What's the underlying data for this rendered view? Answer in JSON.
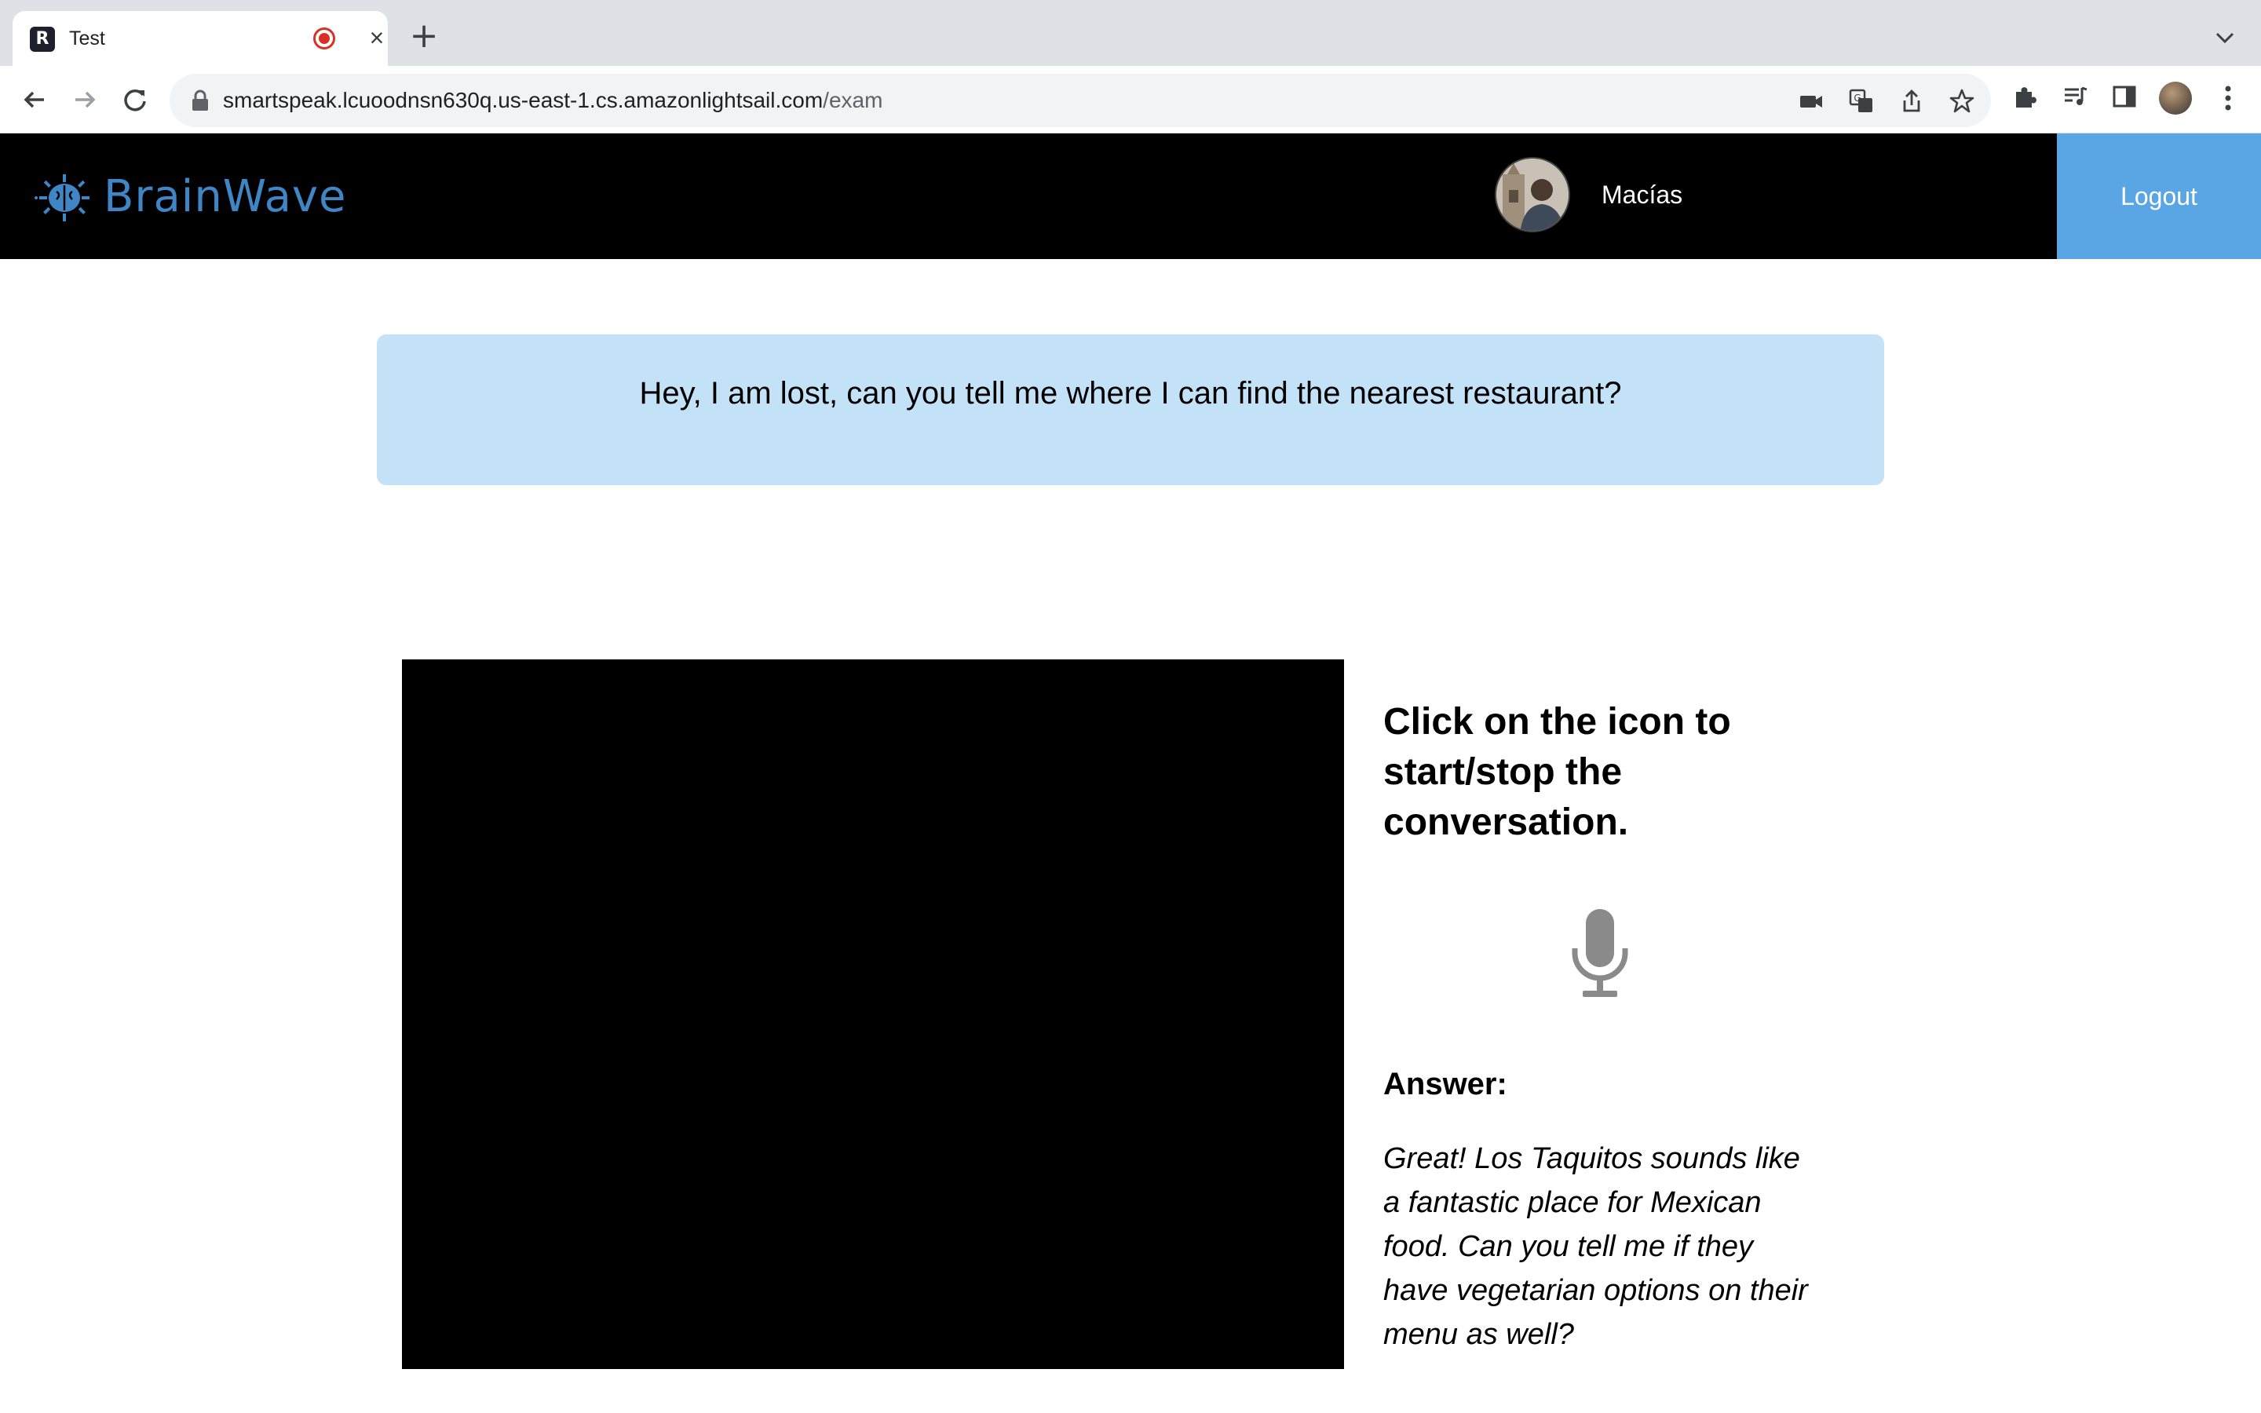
{
  "browser": {
    "tab": {
      "title": "Test",
      "favicon_letter": "R"
    },
    "new_tab_label": "+",
    "close_label": "×",
    "url": {
      "host": "smartspeak.lcuoodnsn630q.us-east-1.cs.amazonlightsail.com",
      "path": "/exam"
    },
    "icons": [
      "back-icon",
      "forward-icon",
      "reload-icon",
      "lock-icon",
      "camera-icon",
      "translate-icon",
      "share-icon",
      "star-icon",
      "extensions-icon",
      "media-icon",
      "side-panel-icon",
      "profile-avatar",
      "menu-icon"
    ]
  },
  "header": {
    "brand_name": "BrainWave",
    "user_name": "Macías",
    "logout_label": "Logout"
  },
  "question": {
    "text": "Hey, I am lost, can you tell me where I can find the nearest restaurant?"
  },
  "conversation": {
    "instructions": "Click on the icon to start/stop the conversation.",
    "answer_label": "Answer:",
    "answer_text": "Great! Los Taquitos sounds like a fantastic place for Mexican food. Can you tell me if they have vegetarian options on their menu as well?"
  },
  "colors": {
    "header_bg": "#000000",
    "brand": "#3f86c6",
    "logout_bg": "#5aa5e3",
    "question_bg": "#c4e2f7",
    "mic": "#8a8a8a"
  }
}
